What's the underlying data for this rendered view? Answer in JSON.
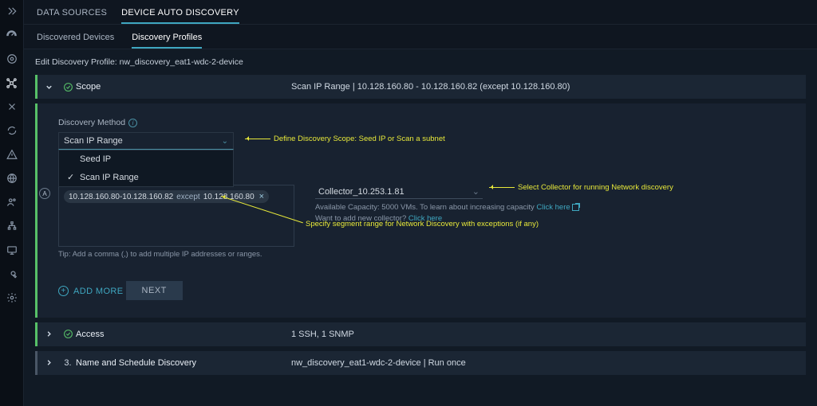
{
  "sidebar_icons": [
    "expand",
    "gauge",
    "shield",
    "net",
    "tools",
    "sync",
    "warn",
    "globe",
    "users",
    "org",
    "monitor",
    "wrench",
    "gear"
  ],
  "topnav": {
    "ds": "DATA SOURCES",
    "dad": "DEVICE AUTO DISCOVERY"
  },
  "subnav": {
    "dd": "Discovered Devices",
    "dp": "Discovery Profiles"
  },
  "page_title": "Edit Discovery Profile: nw_discovery_eat1-wdc-2-device",
  "scope": {
    "header_label": "Scope",
    "header_value": "Scan IP Range | 10.128.160.80 - 10.128.160.82 (except 10.128.160.80)"
  },
  "discovery_method_label": "Discovery Method",
  "method_select": {
    "value": "Scan IP Range",
    "options": [
      "Seed IP",
      "Scan IP Range"
    ]
  },
  "ip_tag": {
    "range": "10.128.160.80-10.128.160.82",
    "except_kw": "except",
    "except_val": "10.128.160.80"
  },
  "ip_tip": "Tip: Add a comma (,) to add multiple IP addresses or ranges.",
  "collector": {
    "placeholder": "Collector_10.253.1.81",
    "cap_line": "Available Capacity: 5000 VMs. To learn about increasing capacity ",
    "cap_link": "Click here",
    "add_line": "Want to add new collector? ",
    "add_link": "Click here"
  },
  "annot": {
    "a1": "Define Discovery Scope: Seed IP or Scan a subnet",
    "a2": "Specify segment range for Network Discovery with exceptions (if any)",
    "a3": "Select Collector for running Network discovery"
  },
  "add_more": "ADD MORE",
  "next": "NEXT",
  "access": {
    "label": "Access",
    "value": "1 SSH, 1 SNMP"
  },
  "sched": {
    "num": "3.",
    "label": "Name and Schedule Discovery",
    "value": "nw_discovery_eat1-wdc-2-device | Run once"
  }
}
